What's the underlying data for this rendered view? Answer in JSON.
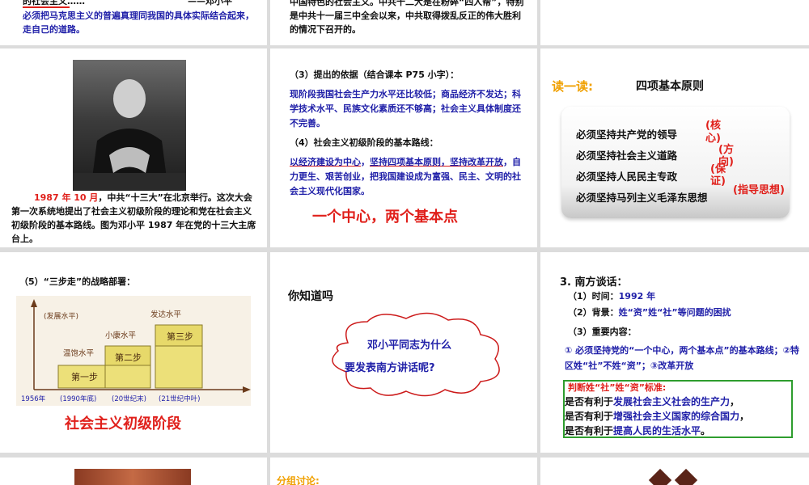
{
  "slide_r1c1": {
    "line_top": "的社会主义……",
    "name_fragment": "——邓小平",
    "quote": "必须把马克思主义的普遍真理同我国的具体实际结合起来，走自己的道路。"
  },
  "slide_r1c2": {
    "text": "中国特色的社会主义。中共十二大是在粉碎“四人帮”，特别是中共十一届三中全会以来，中共取得拨乱反正的伟大胜利的情况下召开的。"
  },
  "slide_r2c1": {
    "caption_date": "1987 年 10 月",
    "caption_rest": "，中共“十三大”在北京举行。这次大会第一次系统地提出了社会主义初级阶段的理论和党在社会主义初级阶段的基本路线。图为邓小平 1987 年在党的十三大主席台上。"
  },
  "slide_r2c2": {
    "basis_heading": "（3）提出的依据（结合课本 P75 小字）：",
    "basis_text": "现阶段我国社会生产力水平还比较低；商品经济不发达；科学技术水平、民族文化素质还不够高；社会主义具体制度还不完善。",
    "line_heading": "（4）社会主义初级阶段的基本路线：",
    "line_part1": "以经济建设为中心",
    "line_sep": "，",
    "line_part2": "坚持四项基本原则，坚持改革开放",
    "line_rest": "，自力更生、艰苦创业，把我国建设成为富强、民主、文明的社会主义现代化国家。",
    "summary": "一个中心，两个基本点"
  },
  "slide_r2c3": {
    "read_label": "读一读:",
    "title": "四项基本原则",
    "principles": [
      "必须坚持共产党的领导",
      "必须坚持社会主义道路",
      "必须坚持人民民主专政",
      "必须坚持马列主义毛泽东思想"
    ],
    "note_core": "(核心)",
    "note_direction": "(方向)",
    "note_guarantee": "(保证)",
    "note_guide": "(指导思想)"
  },
  "slide_r3c1": {
    "heading": "（5）“三步走”的战略部署：",
    "chart": {
      "y_axis_label": "(发展水平)",
      "level_1": "温饱水平",
      "level_2": "小康水平",
      "level_3": "发达水平",
      "step_1": "第一步",
      "step_2": "第二步",
      "step_3": "第三步",
      "x_labels": [
        "1956年",
        "(1990年底)",
        "(20世纪末)",
        "(21世纪中叶)"
      ]
    },
    "bottom_title": "社会主义初级阶段"
  },
  "slide_r3c2": {
    "title": "你知道吗",
    "bubble_line1": "邓小平同志为什么",
    "bubble_line2": "要发表南方讲话呢?"
  },
  "slide_r3c3": {
    "heading": "3. 南方谈话：",
    "time_label": "（1）时间：",
    "time_value": "1992 年",
    "bg_label": "（2）背景：",
    "bg_value": "姓“资”姓“社”等问题的困扰",
    "content_label": "（3）重要内容：",
    "content_text": "① 必须坚持党的“一个中心，两个基本点”的基本路线；②特区姓“社”不姓“资”；③改革开放",
    "box_title": "判断姓“社”姓“资”标准:",
    "box_line1_a": "是否有利于",
    "box_line1_b": "发展社会主义社会的生产力",
    "box_line1_c": "，",
    "box_line2_a": "是否有利于",
    "box_line2_b": "增强社会主义国家的综合国力",
    "box_line2_c": "，",
    "box_line3_a": "是否有利于",
    "box_line3_b": "提高人民的生活水平",
    "box_line3_c": "。"
  },
  "slide_r4c2": {
    "text": "分组讨论:"
  },
  "colors": {
    "background": "#dcdcdc",
    "blue_text": "#1f1fa8",
    "red_text": "#e0201b",
    "orange_text": "#f0a000",
    "green_border": "#2e9d2e"
  }
}
